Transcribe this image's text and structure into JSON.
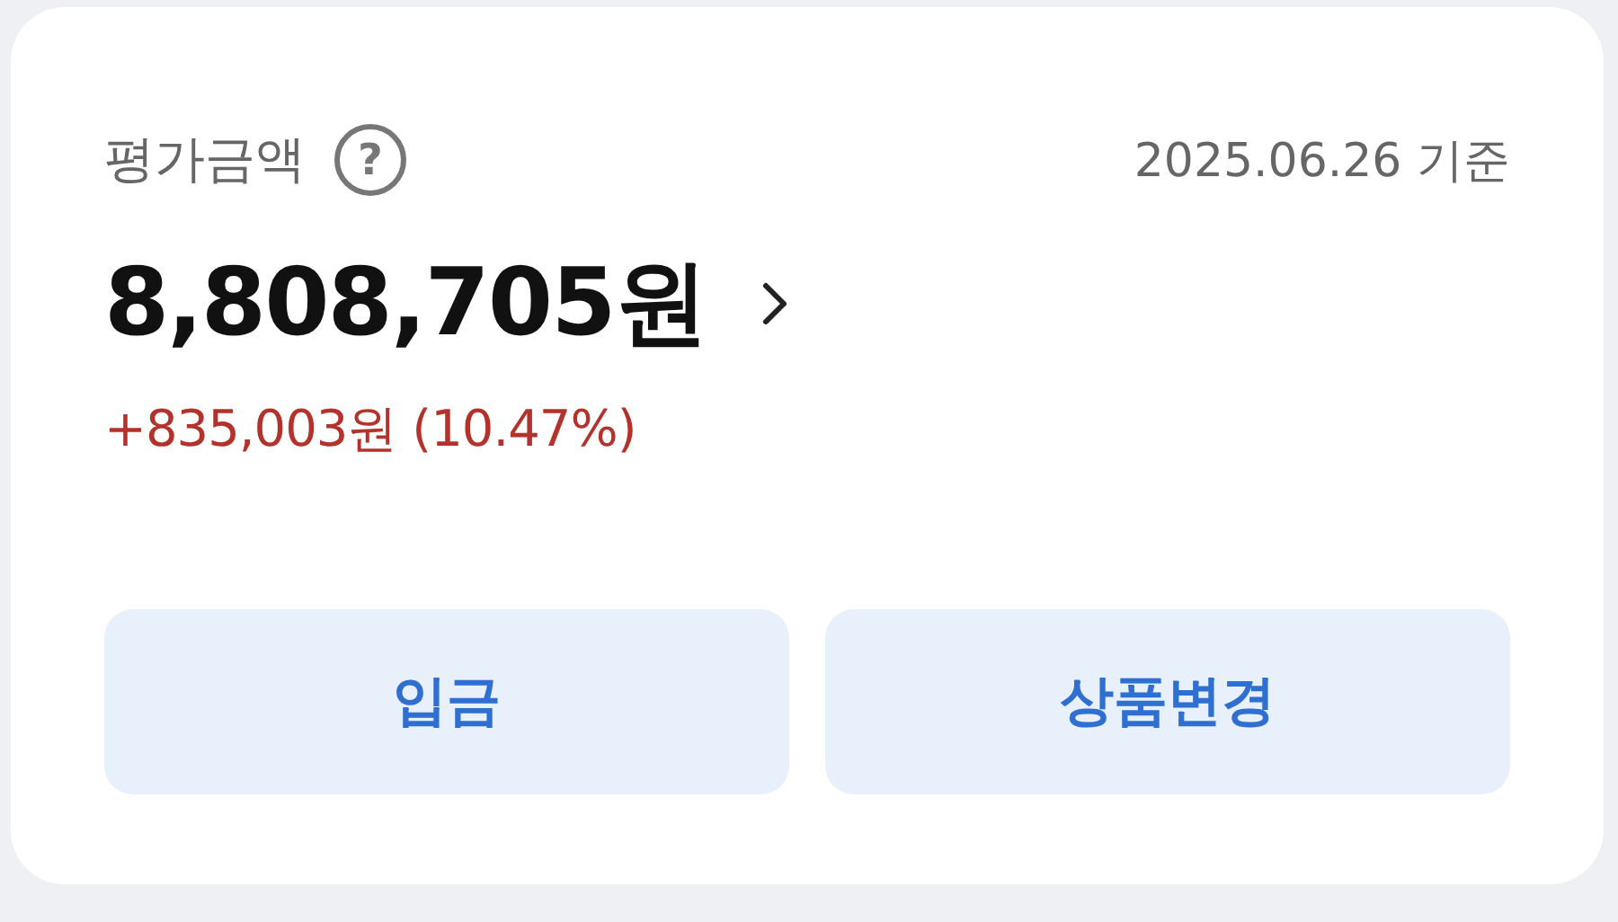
{
  "card": {
    "title": "평가금액",
    "help": "?",
    "date": "2025.06.26 기준",
    "amount": "8,808,705원",
    "change": "+835,003원 (10.47%)"
  },
  "buttons": [
    "입금",
    "상품변경"
  ]
}
